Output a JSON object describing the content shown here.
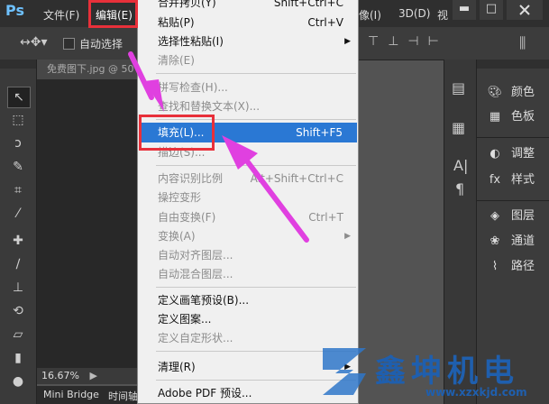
{
  "app": {
    "logo": "Ps"
  },
  "menubar": {
    "file": "文件(F)",
    "edit": "编辑(E)",
    "view_partial": "视",
    "image_partial": "像(I)",
    "threed": "3D(D)",
    "win_min": "▬",
    "win_max": "□"
  },
  "options": {
    "auto_select": "自动选择"
  },
  "document": {
    "tab": "免费图下.jpg @ 50",
    "zoom": "16.67%"
  },
  "bottom_tabs": {
    "bridge": "Mini Bridge",
    "timeline": "时间轴"
  },
  "edit_menu": {
    "merge_copy": {
      "label": "合并拷贝(Y)",
      "shortcut": "Shift+Ctrl+C"
    },
    "paste": {
      "label": "粘贴(P)",
      "shortcut": "Ctrl+V"
    },
    "paste_special": {
      "label": "选择性粘贴(I)"
    },
    "clear": {
      "label": "清除(E)"
    },
    "spell_check": {
      "label": "拼写检查(H)..."
    },
    "find_replace": {
      "label": "查找和替换文本(X)..."
    },
    "fill": {
      "label": "填充(L)...",
      "shortcut": "Shift+F5"
    },
    "stroke": {
      "label": "描边(S)..."
    },
    "content_aware": {
      "label": "内容识别比例",
      "shortcut": "Alt+Shift+Ctrl+C"
    },
    "puppet_warp": {
      "label": "操控变形"
    },
    "free_transform": {
      "label": "自由变换(F)",
      "shortcut": "Ctrl+T"
    },
    "transform": {
      "label": "变换(A)"
    },
    "auto_align": {
      "label": "自动对齐图层..."
    },
    "auto_blend": {
      "label": "自动混合图层..."
    },
    "define_brush": {
      "label": "定义画笔预设(B)..."
    },
    "define_pattern": {
      "label": "定义图案..."
    },
    "define_shape": {
      "label": "定义自定形状..."
    },
    "purge": {
      "label": "清理(R)"
    },
    "pdf_presets": {
      "label": "Adobe PDF 预设..."
    }
  },
  "right_panel": {
    "color": "颜色",
    "swatches": "色板",
    "adjustments": "调整",
    "styles": "样式",
    "layers": "图层",
    "channels": "通道",
    "paths": "路径"
  },
  "watermark": {
    "text": "鑫坤机电",
    "url": "www.xzxkjd.com"
  },
  "colors": {
    "highlight": "#2a78d4",
    "callout_red": "#e8303a",
    "arrow_magenta": "#e040e0"
  }
}
